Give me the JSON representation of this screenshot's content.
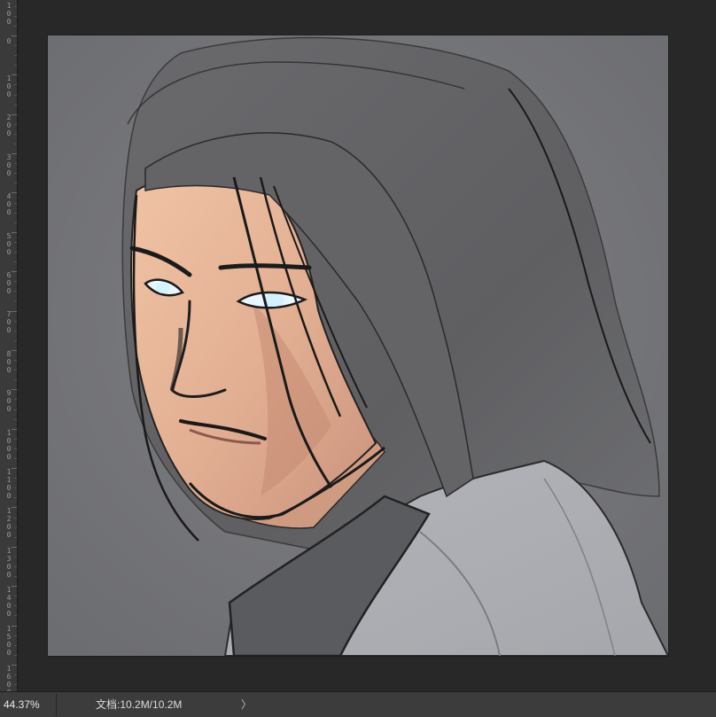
{
  "ruler": {
    "labels": [
      "100",
      "0",
      "100",
      "200",
      "300",
      "400",
      "500",
      "600",
      "700",
      "800",
      "900",
      "1000",
      "1100",
      "1200",
      "1300",
      "1400",
      "1500",
      "1600"
    ]
  },
  "statusbar": {
    "zoom": "44.37%",
    "doc_info": "文档:10.2M/10.2M",
    "menu_arrow": "〉"
  }
}
